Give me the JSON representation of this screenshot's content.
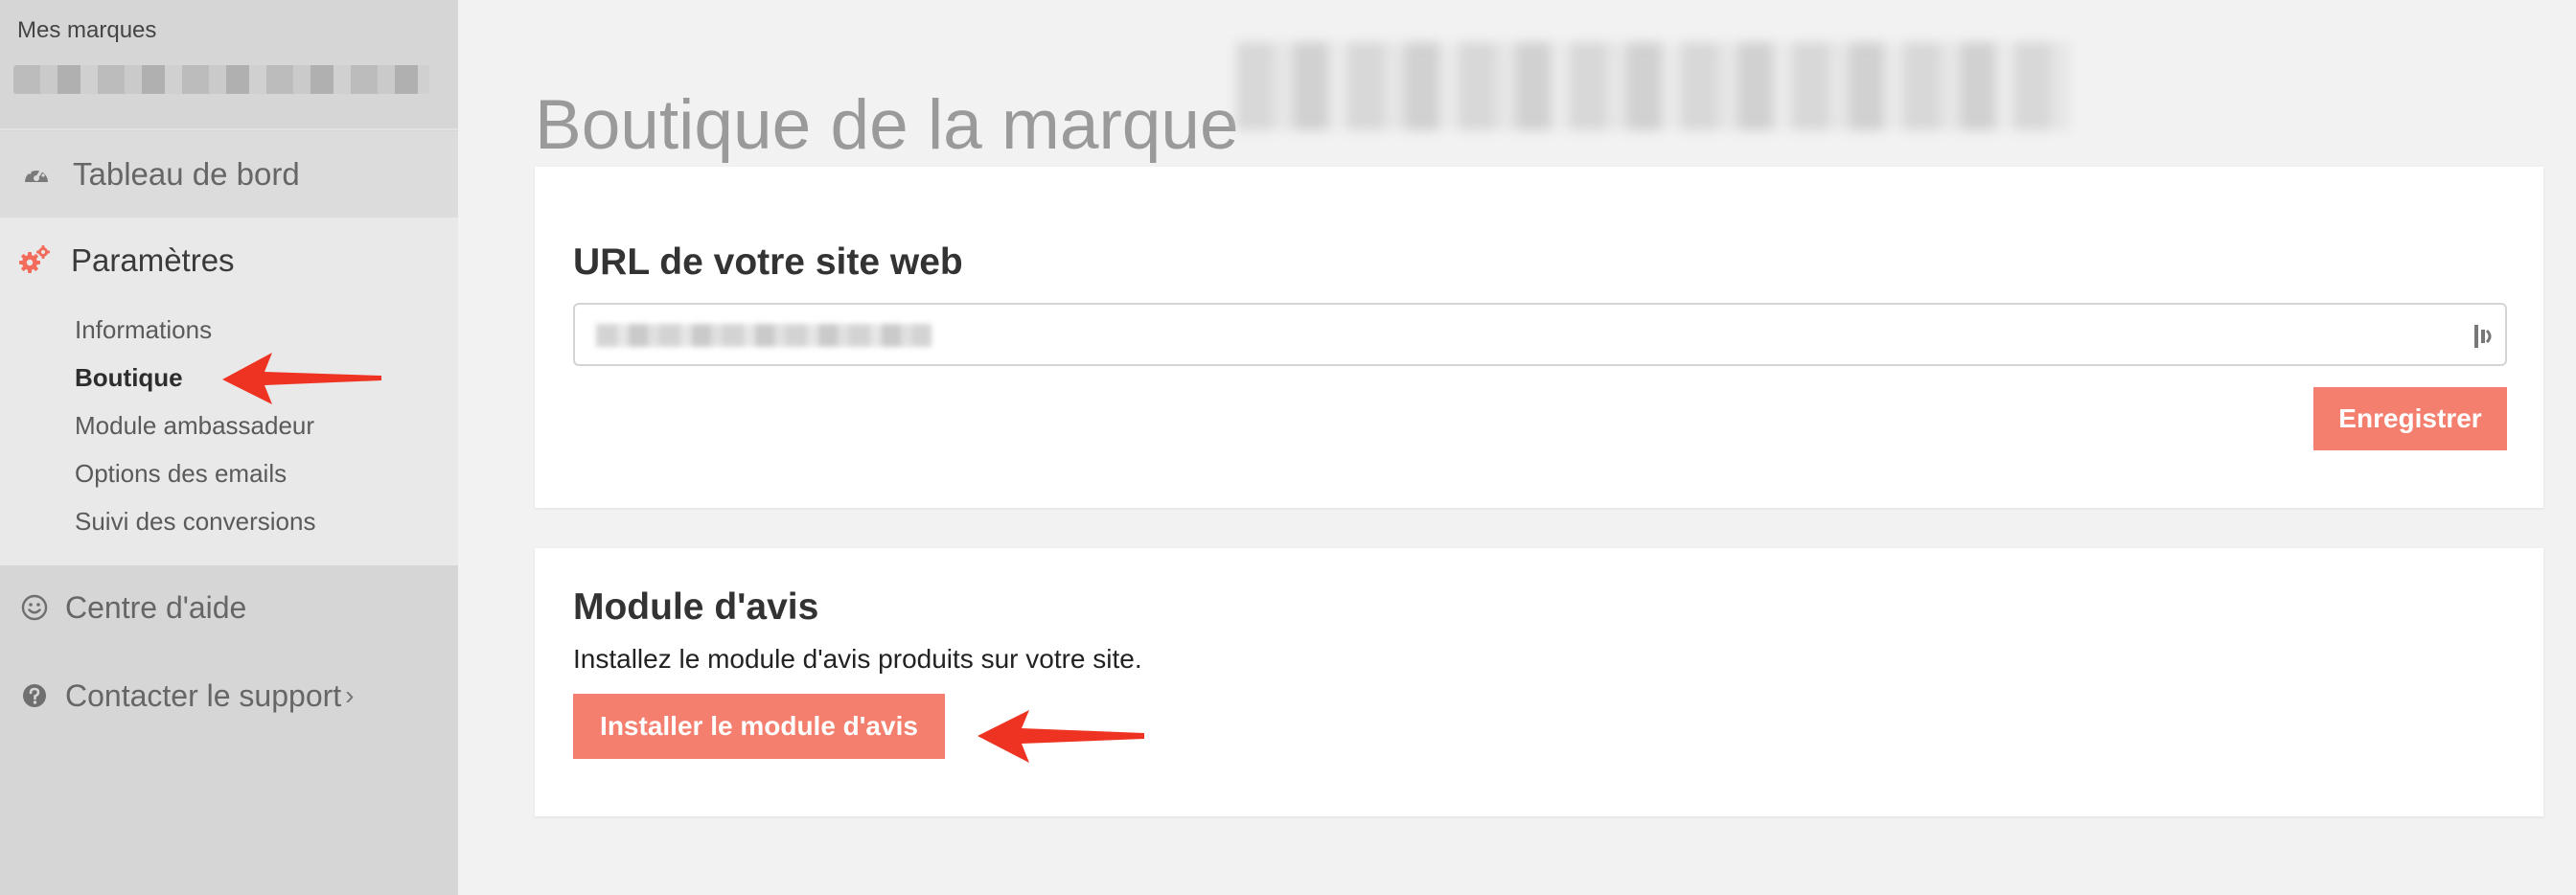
{
  "sidebar": {
    "brand_label": "Mes marques",
    "items": [
      {
        "label": "Tableau de bord",
        "icon": "dashboard-icon"
      },
      {
        "label": "Paramètres",
        "icon": "settings-gears-icon"
      }
    ],
    "submenu": [
      {
        "label": "Informations"
      },
      {
        "label": "Boutique"
      },
      {
        "label": "Module ambassadeur"
      },
      {
        "label": "Options des emails"
      },
      {
        "label": "Suivi des conversions"
      }
    ],
    "help": {
      "label": "Centre d'aide",
      "icon": "smiley-icon"
    },
    "support": {
      "label": "Contacter le support",
      "icon": "question-circle-icon",
      "chevron": "›"
    }
  },
  "page": {
    "title": "Boutique de la marque"
  },
  "url_card": {
    "heading": "URL de votre site web",
    "save_label": "Enregistrer"
  },
  "reviews_card": {
    "heading": "Module d'avis",
    "description": "Installez le module d'avis produits sur votre site.",
    "install_label": "Installer le module d'avis"
  },
  "colors": {
    "accent": "#f47f6e",
    "annotation_arrow": "#ee3322",
    "sidebar_bg": "#d6d6d6",
    "sidebar_active_bg": "#e9e9e9",
    "page_bg": "#f2f2f2"
  }
}
